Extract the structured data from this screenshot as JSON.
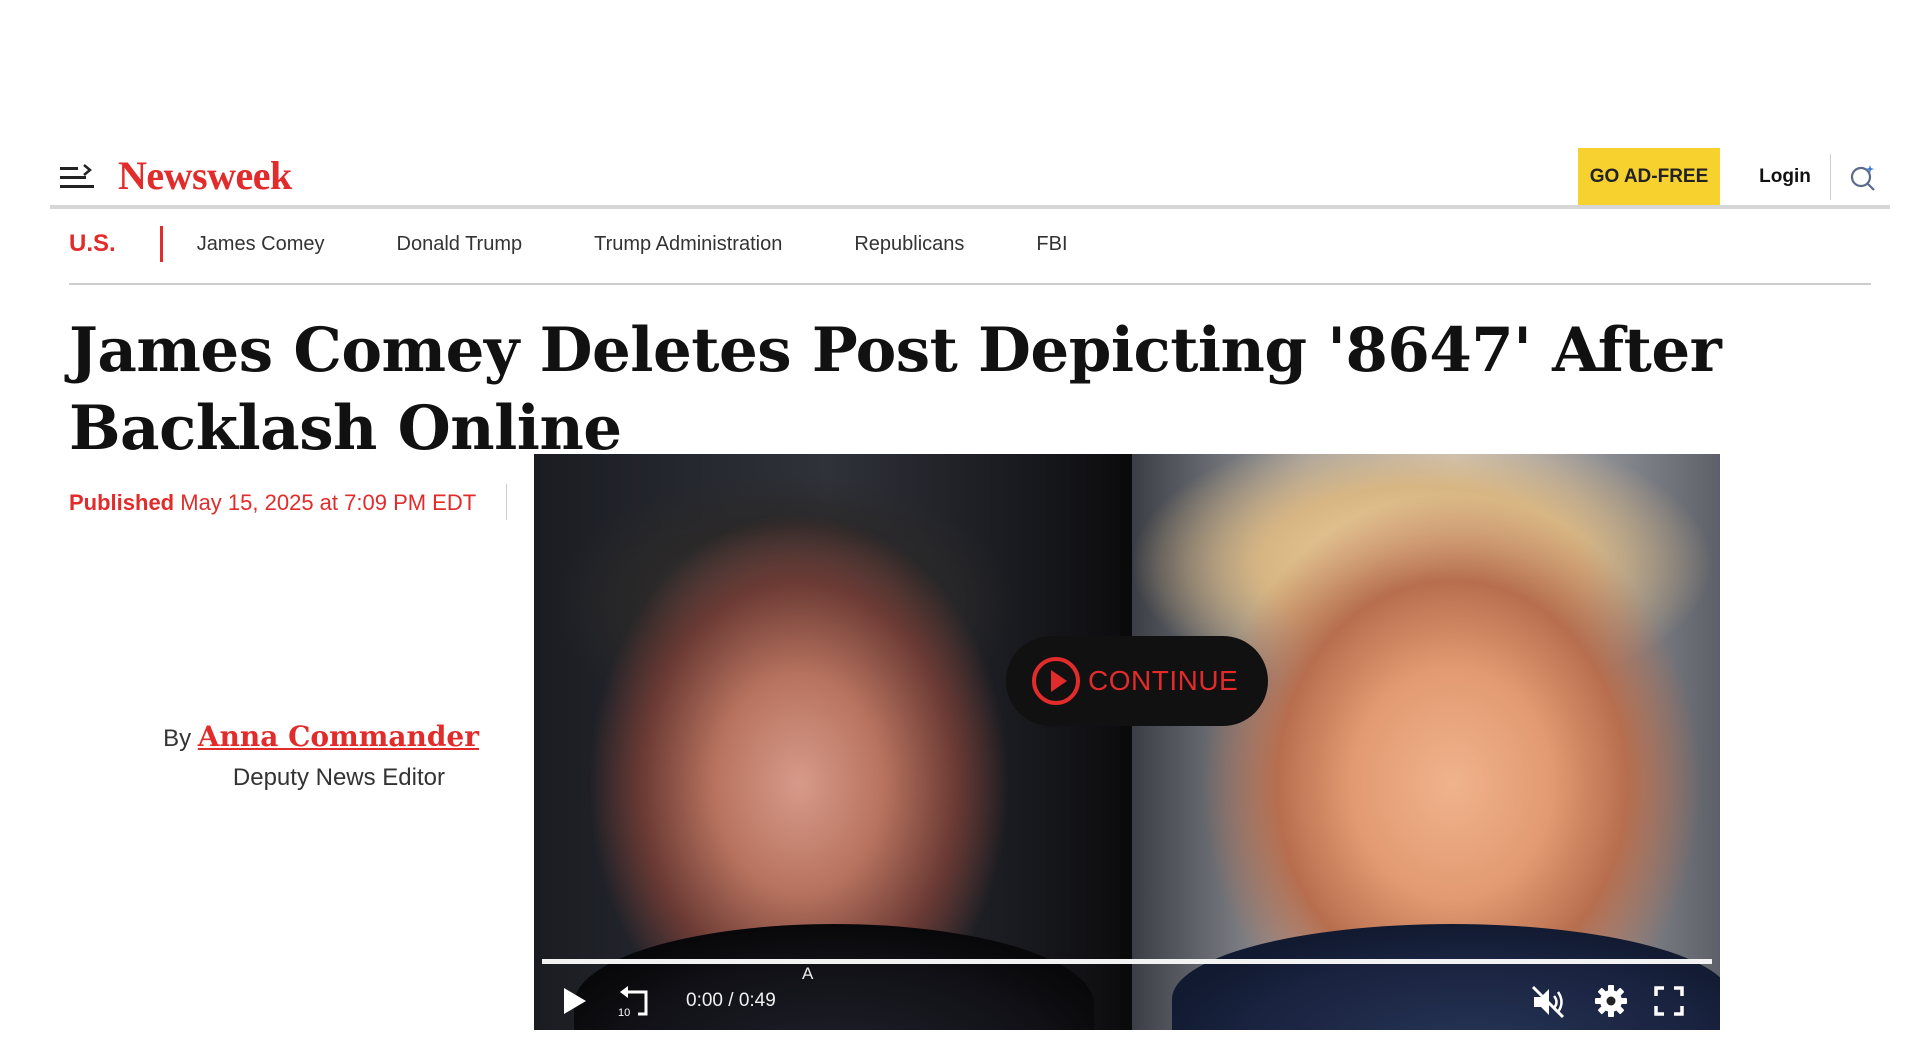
{
  "header": {
    "logo": "Newsweek",
    "ad_free_label": "GO AD-FREE",
    "login_label": "Login",
    "brand_color": "#e22b2b",
    "ad_free_color": "#f7d22f"
  },
  "section_nav": {
    "section": "U.S.",
    "links": [
      "James Comey",
      "Donald Trump",
      "Trump Administration",
      "Republicans",
      "FBI"
    ]
  },
  "article": {
    "headline": "James Comey Deletes Post Depicting '8647' After Backlash Online",
    "published_label": "Published",
    "published_date": "May 15, 2025 at 7:09 PM EDT",
    "byline_prefix": "By",
    "author": "Anna Commander",
    "author_role": "Deputy News Editor"
  },
  "video": {
    "continue_label": "CONTINUE",
    "time": "0:00 / 0:49",
    "marker": "A",
    "progress": 0,
    "muted": true
  }
}
